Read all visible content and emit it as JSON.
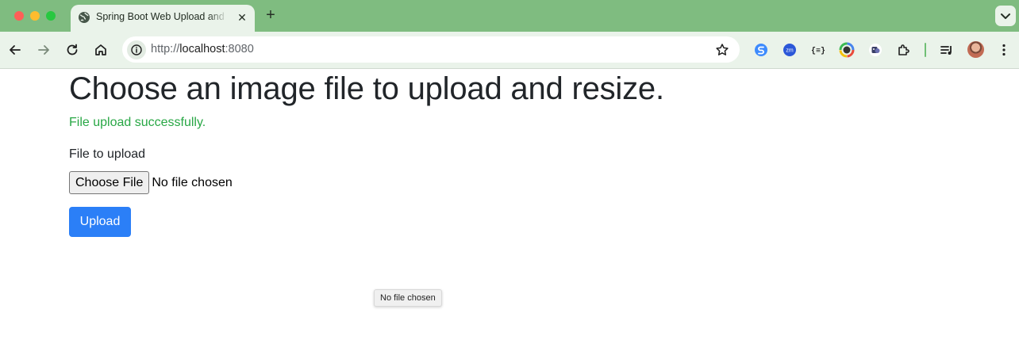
{
  "browser": {
    "tab": {
      "title": "Spring Boot Web Upload and Resize",
      "close_label": "✕"
    },
    "new_tab_label": "+",
    "address": {
      "scheme": "http://",
      "host": "localhost",
      "port": ":8080"
    }
  },
  "page": {
    "heading": "Choose an image file to upload and resize.",
    "status_message": "File upload successfully.",
    "file_label": "File to upload",
    "choose_file_button": "Choose File",
    "no_file_text": "No file chosen",
    "upload_button": "Upload",
    "tooltip_text": "No file chosen"
  },
  "colors": {
    "tab_strip": "#7fbc80",
    "toolbar": "#eaf3ea",
    "success_text": "#28a745",
    "primary_button": "#2b7ff7",
    "heading_text": "#212529"
  },
  "icons": {
    "tab": "globe-icon",
    "nav": [
      "back-arrow-icon",
      "forward-arrow-icon",
      "reload-icon",
      "home-icon"
    ],
    "omnibox": [
      "site-info-icon",
      "bookmark-star-icon"
    ],
    "extensions": [
      "extension-s-icon",
      "extension-zm-icon",
      "extension-json-icon",
      "extension-color-icon",
      "extension-robot-icon",
      "extensions-puzzle-icon",
      "reading-list-icon",
      "profile-avatar-icon",
      "menu-dots-icon"
    ]
  }
}
